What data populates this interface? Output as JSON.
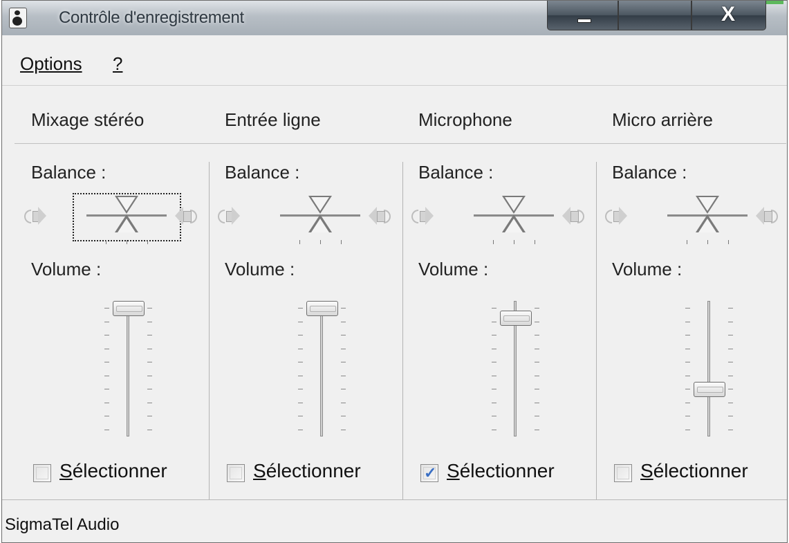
{
  "window": {
    "title": "Contrôle d'enregistrement"
  },
  "menu": {
    "items": [
      {
        "label": "Options"
      },
      {
        "label": "?"
      }
    ]
  },
  "channels": [
    {
      "name": "Mixage stéréo",
      "balance_label": "Balance :",
      "volume_label": "Volume :",
      "volume_fraction": 1.0,
      "select_label_initial": "S",
      "select_label_rest": "électionner",
      "selected": false,
      "focused": true
    },
    {
      "name": "Entrée ligne",
      "balance_label": "Balance :",
      "volume_label": "Volume :",
      "volume_fraction": 1.0,
      "select_label_initial": "S",
      "select_label_rest": "électionner",
      "selected": false,
      "focused": false
    },
    {
      "name": "Microphone",
      "balance_label": "Balance :",
      "volume_label": "Volume :",
      "volume_fraction": 0.92,
      "select_label_initial": "S",
      "select_label_rest": "électionner",
      "selected": true,
      "focused": false
    },
    {
      "name": "Micro arrière",
      "balance_label": "Balance :",
      "volume_label": "Volume :",
      "volume_fraction": 0.33,
      "select_label_initial": "S",
      "select_label_rest": "électionner",
      "selected": false,
      "focused": false
    }
  ],
  "status": {
    "device": "SigmaTel Audio"
  },
  "colors": {
    "checkmark": "#3a6fc4",
    "title_text": "#2f3942"
  },
  "icons": {
    "app": "speaker-app-icon",
    "minimize": "minimize-icon",
    "maximize": "maximize-icon",
    "close": "close-icon",
    "speaker_left": "speaker-left-icon",
    "speaker_right": "speaker-right-icon",
    "check": "checkmark-icon"
  }
}
